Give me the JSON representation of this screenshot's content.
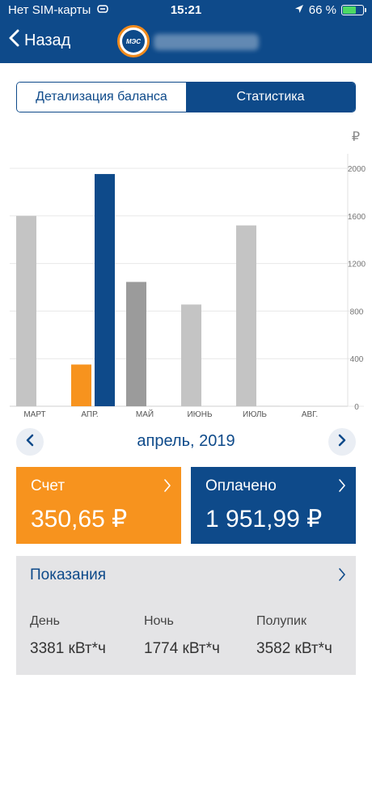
{
  "status_bar": {
    "carrier": "Нет SIM-карты",
    "time": "15:21",
    "battery_percent": "66 %",
    "battery_level": 0.66,
    "icons": [
      "sync-icon",
      "location-arrow-icon",
      "battery-icon"
    ]
  },
  "nav": {
    "back_label": "Назад",
    "logo_text": "МЭС"
  },
  "tabs": [
    {
      "label": "Детализация баланса",
      "active": false
    },
    {
      "label": "Статистика",
      "active": true
    }
  ],
  "colors": {
    "brand_blue": "#0e4a8a",
    "accent_orange": "#f7931e",
    "bar_grey_light": "#c4c4c4",
    "bar_grey_dark": "#9b9b9b",
    "readings_bg": "#e4e4e6"
  },
  "chart_data": {
    "type": "bar",
    "currency_symbol": "₽",
    "categories": [
      "МАРТ",
      "АПР.",
      "МАЙ",
      "ИЮНЬ",
      "ИЮЛЬ",
      "АВГ."
    ],
    "yticks": [
      0,
      400,
      800,
      1200,
      1600,
      2000
    ],
    "ylim": [
      0,
      2000
    ],
    "grid": true,
    "series": [
      {
        "values": [
          1600,
          350.65,
          1045,
          855,
          1520,
          0
        ]
      },
      {
        "values": [
          0,
          1951.99,
          0,
          0,
          3,
          0
        ]
      }
    ]
  },
  "month_nav": {
    "label": "апрель, 2019"
  },
  "cards": {
    "bill": {
      "title": "Счет",
      "value": "350,65 ₽"
    },
    "paid": {
      "title": "Оплачено",
      "value": "1 951,99 ₽"
    }
  },
  "readings": {
    "title": "Показания",
    "items": [
      {
        "label": "День",
        "value": "3381 кВт*ч"
      },
      {
        "label": "Ночь",
        "value": "1774 кВт*ч"
      },
      {
        "label": "Полупик",
        "value": "3582 кВт*ч"
      }
    ]
  }
}
